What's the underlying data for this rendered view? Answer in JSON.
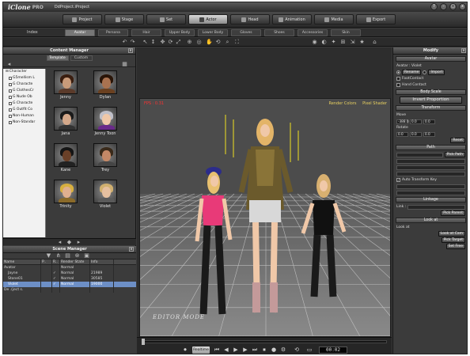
{
  "titlebar": {
    "logo": "iClone",
    "logo_suffix": "PRO",
    "project": "DdProject.iProject",
    "buttons": [
      "?",
      "–",
      "□",
      "x"
    ]
  },
  "modules": {
    "tabs": [
      {
        "label": "Project",
        "icon": "folder-icon"
      },
      {
        "label": "Stage",
        "icon": "stage-icon"
      },
      {
        "label": "Set",
        "icon": "set-icon"
      },
      {
        "label": "Actor",
        "icon": "actor-icon",
        "active": true
      },
      {
        "label": "Head",
        "icon": "head-icon"
      },
      {
        "label": "Animation",
        "icon": "animation-icon"
      },
      {
        "label": "Media",
        "icon": "media-icon"
      },
      {
        "label": "Export",
        "icon": "export-icon"
      }
    ]
  },
  "subtabs": {
    "label": "Index",
    "items": [
      "Avatar",
      "Persona",
      "Hair",
      "Upper Body",
      "Lower Body",
      "Gloves",
      "Shoes",
      "Accessories",
      "Skin"
    ],
    "active": "Avatar"
  },
  "content_manager": {
    "title": "Content Manager",
    "tabs": [
      "Template",
      "Custom"
    ],
    "active_tab": "Template",
    "tree": [
      {
        "label": "Character",
        "level": 0
      },
      {
        "label": "G5mellism L",
        "level": 1
      },
      {
        "label": "G Characte",
        "level": 1
      },
      {
        "label": "G ClothesCr",
        "level": 1
      },
      {
        "label": "G Nude Ob",
        "level": 1
      },
      {
        "label": "G Characte",
        "level": 1
      },
      {
        "label": "G Outfit Co",
        "level": 1
      },
      {
        "label": "Non-Human",
        "level": 1
      },
      {
        "label": "Non-Standar",
        "level": 1
      }
    ],
    "thumbnails": [
      {
        "label": "Jenny",
        "skin": "#c99b7a",
        "hair": "#3a1e10",
        "cloth": "#5a3a2a"
      },
      {
        "label": "Dylan",
        "skin": "#a97250",
        "hair": "#2a1508",
        "cloth": "#6a4020"
      },
      {
        "label": "Jana",
        "skin": "#d4a88a",
        "hair": "#1a1a1a",
        "cloth": "#333"
      },
      {
        "label": "Jenny Toon",
        "skin": "#f0c8a8",
        "hair": "#bfbfc8",
        "cloth": "#6a2a8a"
      },
      {
        "label": "Kane",
        "skin": "#6a4028",
        "hair": "#151515",
        "cloth": "#222"
      },
      {
        "label": "Trey",
        "skin": "#c48866",
        "hair": "#3a2a1a",
        "cloth": "#454545"
      },
      {
        "label": "Trinity",
        "skin": "#e0b090",
        "hair": "#d8b040",
        "cloth": "#8a6a2a"
      },
      {
        "label": "Violet",
        "skin": "#e6c0a0",
        "hair": "#d0b070",
        "cloth": "#5a5a5a"
      }
    ]
  },
  "scene_manager": {
    "title": "Scene Manager",
    "columns": [
      "Name",
      "P..",
      "R..",
      "Render State",
      "Info"
    ],
    "rows": [
      {
        "name": "Avatar",
        "indent": 0,
        "p": "",
        "r": "",
        "state": "Normal",
        "info": "",
        "selected": false
      },
      {
        "name": "Jayne",
        "indent": 1,
        "p": "",
        "r": "✓",
        "state": "Normal",
        "info": "21989",
        "selected": false
      },
      {
        "name": "Stone01",
        "indent": 1,
        "p": "",
        "r": "✓",
        "state": "Normal",
        "info": "30585",
        "selected": false
      },
      {
        "name": "Violet",
        "indent": 1,
        "p": "",
        "r": "✓",
        "state": "Normal",
        "info": "19000",
        "selected": true
      },
      {
        "name": "De .(ject s.",
        "indent": 0,
        "p": "",
        "r": "",
        "state": "",
        "info": "",
        "selected": false
      }
    ]
  },
  "viewport": {
    "fps": "FPS : 0.31",
    "options": [
      "Render Colors",
      "Pixel Shader"
    ],
    "mode": "EDITOR MODE",
    "colors": {
      "sky_top": "#3a3a3a",
      "floor": "#7b7b7b",
      "grid": "#c8c8c8"
    },
    "figures": [
      {
        "name": "left",
        "top": "#e83a78",
        "hair": "#e8c070",
        "pants": "#1a1a1a",
        "hat": "#2a2a7a"
      },
      {
        "name": "center",
        "top": "#6a5a30",
        "hair": "#e0b060",
        "skirt": "#d0d0d0",
        "boots": "#b07080"
      },
      {
        "name": "right",
        "top": "#111111",
        "hair": "#d8b070",
        "pants": "#1a1a1a"
      }
    ]
  },
  "timeline": {
    "realtime": "Realtime",
    "counter": "00:02",
    "buttons": [
      "⏮",
      "◀",
      "▶",
      "▶",
      "⏭",
      "⏹",
      "●",
      "⚙"
    ]
  },
  "modify": {
    "title": "Modify",
    "sections": {
      "avatar": "Avatar",
      "avatar_name": "Avatar : Violet",
      "rename": "Rename",
      "import": "Import",
      "foot_contact": "FootContact",
      "hand_contact": "Hand Contact",
      "body_scale": "Body Scale",
      "invert_proportion": "Invert Proportion",
      "transform": "Transform",
      "move_label": "Move",
      "move_values": [
        "-388.0",
        "0.0",
        "0.0"
      ],
      "rotate_label": "Rotate",
      "rotate_values": [
        "0.0",
        "0.0",
        "0.0"
      ],
      "reset": "Reset",
      "path": "Path",
      "pick_path": "Pick Path",
      "auto_transform": "Auto Transform Key",
      "linkage": "Linkage",
      "link_label": "Link :",
      "pick_parent": "Pick Parent",
      "look_at": "Look at",
      "look_at_label": "Look at",
      "look_at_cam": "Look at Cam",
      "pick_target": "Pick Target",
      "set_free": "Set Free"
    }
  }
}
